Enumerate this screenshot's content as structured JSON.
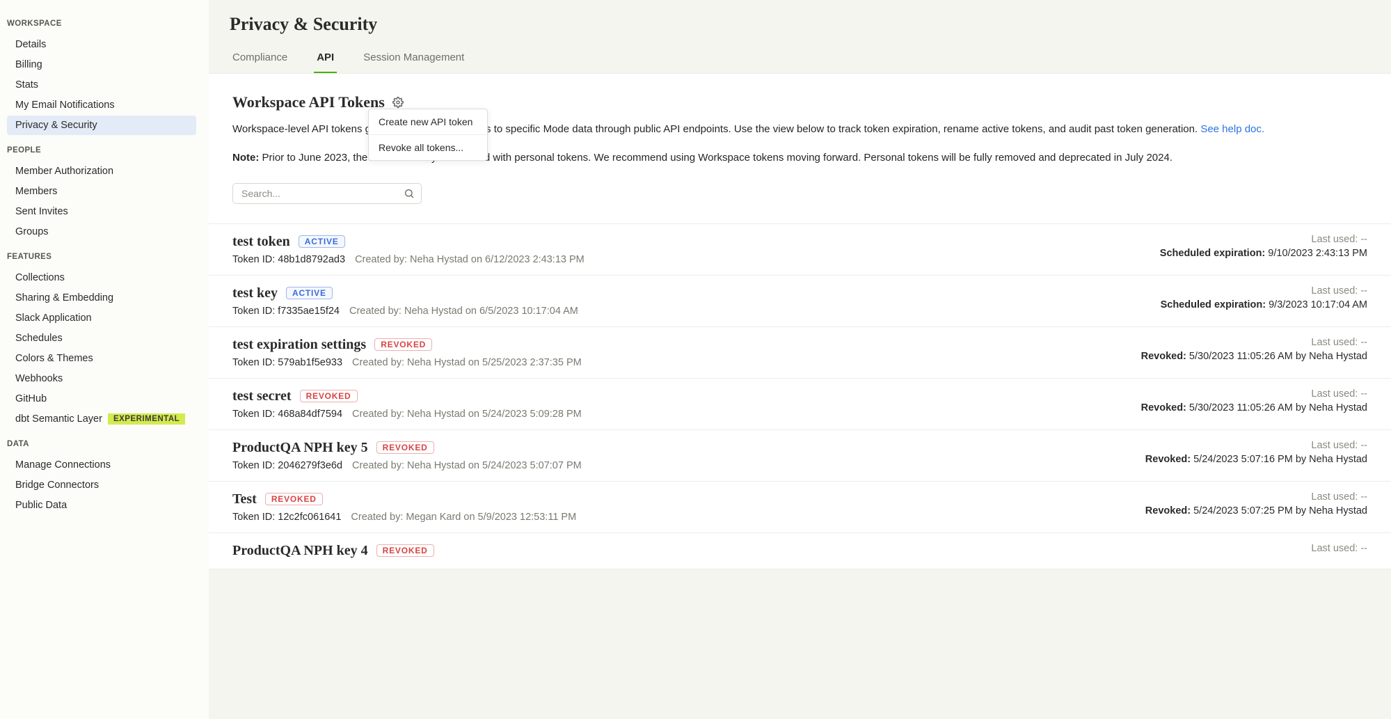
{
  "sidebar": {
    "groups": [
      {
        "title": "WORKSPACE",
        "items": [
          {
            "label": "Details",
            "selected": false
          },
          {
            "label": "Billing",
            "selected": false
          },
          {
            "label": "Stats",
            "selected": false
          },
          {
            "label": "My Email Notifications",
            "selected": false
          },
          {
            "label": "Privacy & Security",
            "selected": true
          }
        ]
      },
      {
        "title": "PEOPLE",
        "items": [
          {
            "label": "Member Authorization"
          },
          {
            "label": "Members"
          },
          {
            "label": "Sent Invites"
          },
          {
            "label": "Groups"
          }
        ]
      },
      {
        "title": "FEATURES",
        "items": [
          {
            "label": "Collections"
          },
          {
            "label": "Sharing & Embedding"
          },
          {
            "label": "Slack Application"
          },
          {
            "label": "Schedules"
          },
          {
            "label": "Colors & Themes"
          },
          {
            "label": "Webhooks"
          },
          {
            "label": "GitHub"
          },
          {
            "label": "dbt Semantic Layer",
            "badge": "EXPERIMENTAL"
          }
        ]
      },
      {
        "title": "DATA",
        "items": [
          {
            "label": "Manage Connections"
          },
          {
            "label": "Bridge Connectors"
          },
          {
            "label": "Public Data"
          }
        ]
      }
    ]
  },
  "page": {
    "title": "Privacy & Security",
    "tabs": [
      {
        "label": "Compliance",
        "active": false
      },
      {
        "label": "API",
        "active": true
      },
      {
        "label": "Session Management",
        "active": false
      }
    ]
  },
  "section": {
    "title": "Workspace API Tokens",
    "description_pre": "Workspace-level API tokens grant programmatic access to specific Mode data through public API endpoints. Use the view below to track token expiration, rename active tokens, and audit past token generation. ",
    "description_link": "See help doc.",
    "note_label": "Note:",
    "note_body": " Prior to June 2023, the API could only be invoked with personal tokens. We recommend using Workspace tokens moving forward. Personal tokens will be fully removed and deprecated in July 2024.",
    "search_placeholder": "Search..."
  },
  "dropdown": {
    "items": [
      "Create new API token",
      "Revoke all tokens..."
    ]
  },
  "tokens_labels": {
    "token_id_prefix": "Token ID: ",
    "created_by_prefix": "Created by: ",
    "last_used_prefix": "Last used: ",
    "scheduled_prefix": "Scheduled expiration:",
    "revoked_prefix": "Revoked:",
    "active_badge": "ACTIVE",
    "revoked_badge": "REVOKED"
  },
  "tokens": [
    {
      "name": "test token",
      "status": "active",
      "token_id": "48b1d8792ad3",
      "created_by": "Neha Hystad on 6/12/2023 2:43:13 PM",
      "last_used": "--",
      "expire_label": "Scheduled expiration:",
      "expire_value": " 9/10/2023 2:43:13 PM"
    },
    {
      "name": "test key",
      "status": "active",
      "token_id": "f7335ae15f24",
      "created_by": "Neha Hystad on 6/5/2023 10:17:04 AM",
      "last_used": "--",
      "expire_label": "Scheduled expiration:",
      "expire_value": " 9/3/2023 10:17:04 AM"
    },
    {
      "name": "test expiration settings",
      "status": "revoked",
      "token_id": "579ab1f5e933",
      "created_by": "Neha Hystad on 5/25/2023 2:37:35 PM",
      "last_used": "--",
      "expire_label": "Revoked:",
      "expire_value": " 5/30/2023 11:05:26 AM by Neha Hystad"
    },
    {
      "name": "test secret",
      "status": "revoked",
      "token_id": "468a84df7594",
      "created_by": "Neha Hystad on 5/24/2023 5:09:28 PM",
      "last_used": "--",
      "expire_label": "Revoked:",
      "expire_value": " 5/30/2023 11:05:26 AM by Neha Hystad"
    },
    {
      "name": "ProductQA NPH key 5",
      "status": "revoked",
      "token_id": "2046279f3e6d",
      "created_by": "Neha Hystad on 5/24/2023 5:07:07 PM",
      "last_used": "--",
      "expire_label": "Revoked:",
      "expire_value": " 5/24/2023 5:07:16 PM by Neha Hystad"
    },
    {
      "name": "Test",
      "status": "revoked",
      "token_id": "12c2fc061641",
      "created_by": "Megan Kard on 5/9/2023 12:53:11 PM",
      "last_used": "--",
      "expire_label": "Revoked:",
      "expire_value": " 5/24/2023 5:07:25 PM by Neha Hystad"
    },
    {
      "name": "ProductQA NPH key 4",
      "status": "revoked",
      "token_id": "",
      "created_by": "",
      "last_used": "--",
      "expire_label": "",
      "expire_value": ""
    }
  ]
}
